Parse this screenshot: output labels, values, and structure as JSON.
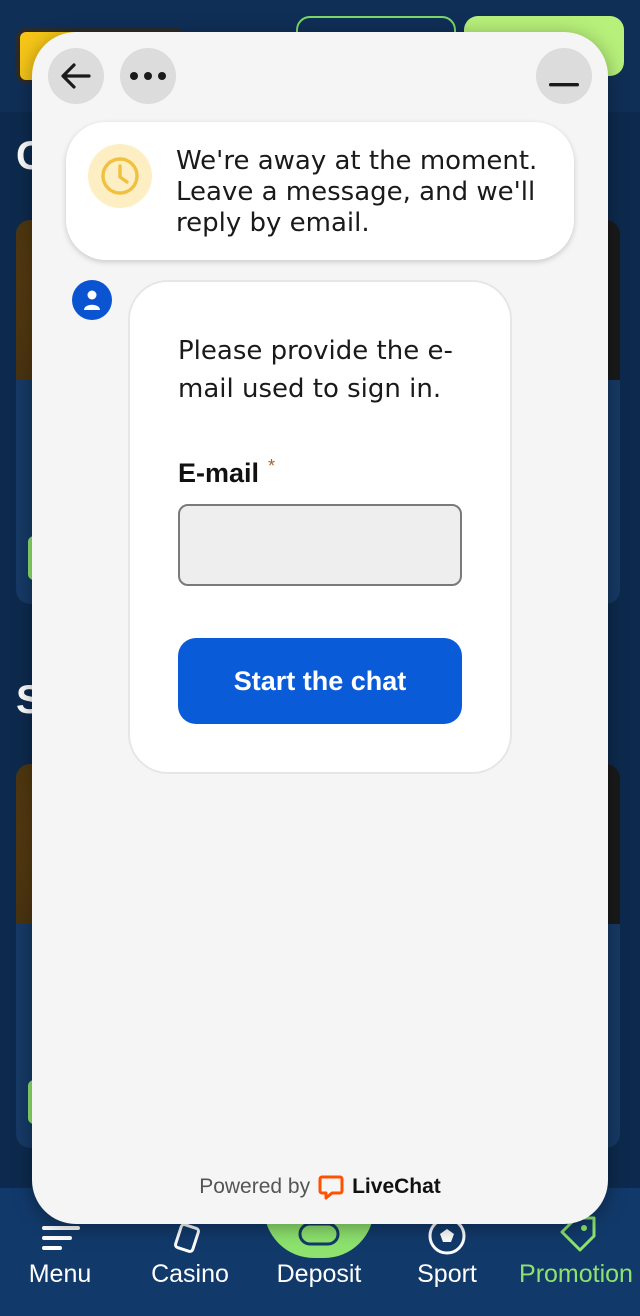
{
  "widget": {
    "notice_text": "We're away at the moment. Leave a message, and we'll reply by email.",
    "form_intro": "Please provide the e-mail used to sign in.",
    "email_label": "E-mail",
    "required_mark": "*",
    "email_value": "",
    "start_button": "Start the chat",
    "powered_by": "Powered by",
    "brand": "LiveChat",
    "icons": {
      "back": "arrow-left-icon",
      "more": "more-dots-icon",
      "minimize": "minimize-icon",
      "notice": "clock-icon",
      "agent": "agent-avatar-icon",
      "brand": "livechat-logo-icon"
    },
    "colors": {
      "primary": "#0a5bd8",
      "notice_icon": "#f0c040",
      "required": "#b45a2b",
      "brand_logo": "#ff5100"
    }
  },
  "site": {
    "section_letters": [
      "C",
      "S"
    ],
    "nav": [
      {
        "label": "Menu",
        "icon": "menu-icon"
      },
      {
        "label": "Casino",
        "icon": "cards-icon"
      },
      {
        "label": "Deposit",
        "icon": "gamepad-icon"
      },
      {
        "label": "Sport",
        "icon": "soccer-ball-icon"
      },
      {
        "label": "Promotion",
        "icon": "tag-icon"
      }
    ],
    "active_nav": "Promotion",
    "colors": {
      "accent": "#8ee36e",
      "header": "#102f57",
      "nav": "#113a6b"
    }
  }
}
